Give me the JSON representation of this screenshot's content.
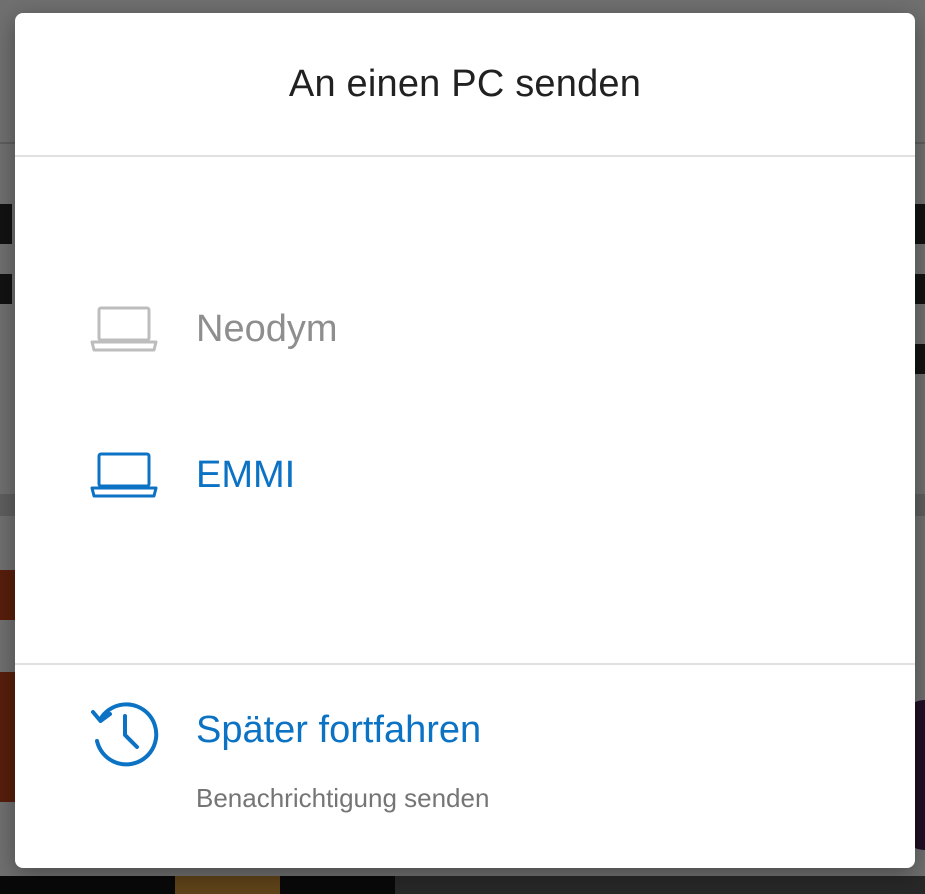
{
  "dialog": {
    "title": "An einen PC senden"
  },
  "devices": [
    {
      "name": "Neodym",
      "icon": "laptop-icon",
      "state": "inactive",
      "color": "#bdbdbd"
    },
    {
      "name": "EMMI",
      "icon": "laptop-icon",
      "state": "active",
      "color": "#0b72c4"
    }
  ],
  "later": {
    "title": "Später fortfahren",
    "subtitle": "Benachrichtigung senden",
    "icon": "history-icon"
  },
  "colors": {
    "accent": "#0b72c4",
    "title_text": "#212121",
    "muted_text": "#8e8e8e",
    "divider": "#e0e0e0"
  }
}
